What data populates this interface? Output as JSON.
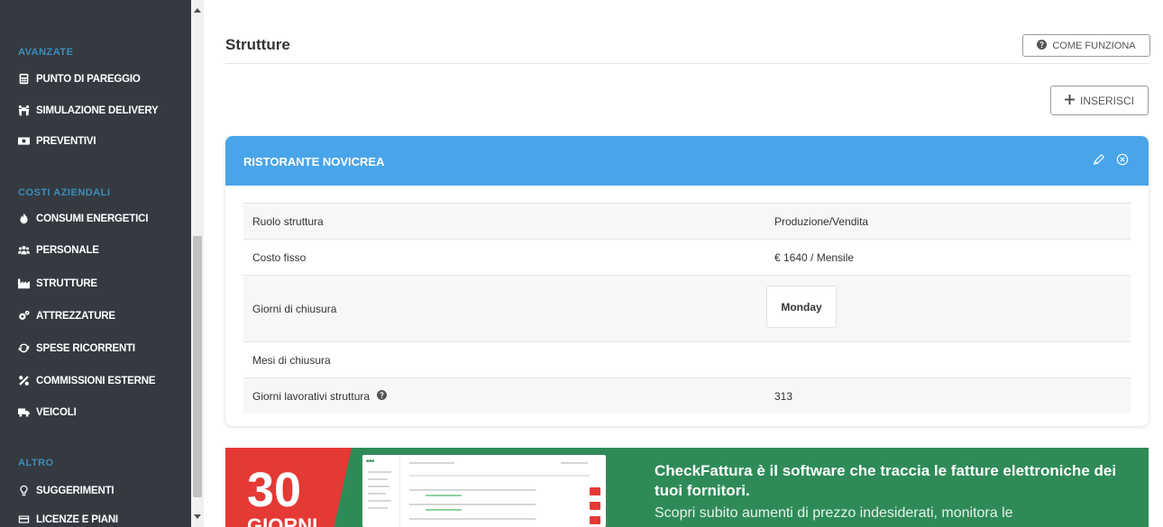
{
  "sidebar": {
    "sections": [
      {
        "label": "AVANZATE"
      },
      {
        "label": "COSTI AZIENDALI"
      },
      {
        "label": "ALTRO"
      }
    ],
    "items": [
      {
        "label": "PUNTO DI PAREGGIO",
        "icon": "calculator-icon"
      },
      {
        "label": "SIMULAZIONE DELIVERY",
        "icon": "people-carry-icon"
      },
      {
        "label": "PREVENTIVI",
        "icon": "money-bill-icon"
      },
      {
        "label": "CONSUMI ENERGETICI",
        "icon": "fire-icon"
      },
      {
        "label": "PERSONALE",
        "icon": "users-icon"
      },
      {
        "label": "STRUTTURE",
        "icon": "industry-icon"
      },
      {
        "label": "ATTREZZATURE",
        "icon": "cogs-icon"
      },
      {
        "label": "SPESE RICORRENTI",
        "icon": "sync-icon"
      },
      {
        "label": "COMMISSIONI ESTERNE",
        "icon": "percent-icon"
      },
      {
        "label": "VEICOLI",
        "icon": "truck-icon"
      },
      {
        "label": "SUGGERIMENTI",
        "icon": "lightbulb-icon"
      },
      {
        "label": "LICENZE E PIANI",
        "icon": "credit-card-icon"
      }
    ]
  },
  "header": {
    "title": "Strutture",
    "help_label": "COME FUNZIONA",
    "insert_label": "INSERISCI"
  },
  "card": {
    "title": "RISTORANTE NOVICREA",
    "rows": [
      {
        "label": "Ruolo struttura",
        "value": "Produzione/Vendita"
      },
      {
        "label": "Costo fisso",
        "value": "€ 1640 / Mensile"
      },
      {
        "label": "Giorni di chiusura",
        "value": "Monday"
      },
      {
        "label": "Mesi di chiusura",
        "value": ""
      },
      {
        "label": "Giorni lavorativi struttura",
        "value": "313"
      }
    ]
  },
  "banner": {
    "number": "30",
    "unit": "GIORNI",
    "headline": "CheckFattura è il software che traccia le fatture elettroniche dei tuoi fornitori.",
    "subline": "Scopri subito aumenti di prezzo indesiderati, monitora le"
  },
  "colors": {
    "sidebar_bg": "#343a40",
    "section_label": "#3c8dbc",
    "card_header": "#49a5ea",
    "banner_green": "#2e8b57",
    "banner_red": "#e53935"
  }
}
